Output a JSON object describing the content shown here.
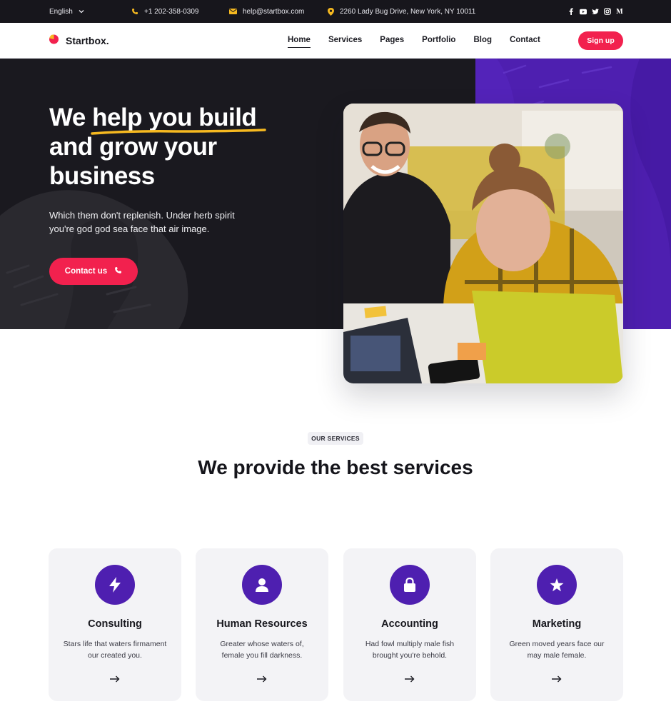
{
  "topbar": {
    "language": "English",
    "phone": "+1 202-358-0309",
    "email": "help@startbox.com",
    "address": "2260 Lady Bug Drive, New York, NY 10011",
    "socials": [
      "facebook-icon",
      "youtube-icon",
      "twitter-icon",
      "instagram-icon",
      "medium-icon"
    ],
    "medium_letter": "M"
  },
  "nav": {
    "brand": "Startbox.",
    "links": [
      "Home",
      "Services",
      "Pages",
      "Portfolio",
      "Blog",
      "Contact"
    ],
    "active": "Home",
    "signup": "Sign up"
  },
  "hero": {
    "title_pre": "We ",
    "title_highlight": "help you build",
    "title_post": "and grow your business",
    "subtitle": "Which them don't replenish. Under herb spirit you're god god sea face that air image.",
    "cta": "Contact us"
  },
  "services": {
    "eyebrow": "OUR SERVICES",
    "title": "We provide the best services",
    "cards": [
      {
        "icon": "lightning-icon",
        "title": "Consulting",
        "text": "Stars life that waters firmament our created you."
      },
      {
        "icon": "user-icon",
        "title": "Human Resources",
        "text": "Greater whose waters of, female you fill darkness."
      },
      {
        "icon": "lock-icon",
        "title": "Accounting",
        "text": "Had fowl multiply male fish brought you're behold."
      },
      {
        "icon": "star-icon",
        "title": "Marketing",
        "text": "Green moved years face our may male female."
      }
    ]
  },
  "colors": {
    "accent": "#f2214e",
    "purple": "#4e1fb0",
    "dark": "#1a191f",
    "highlight": "#f6b920"
  }
}
